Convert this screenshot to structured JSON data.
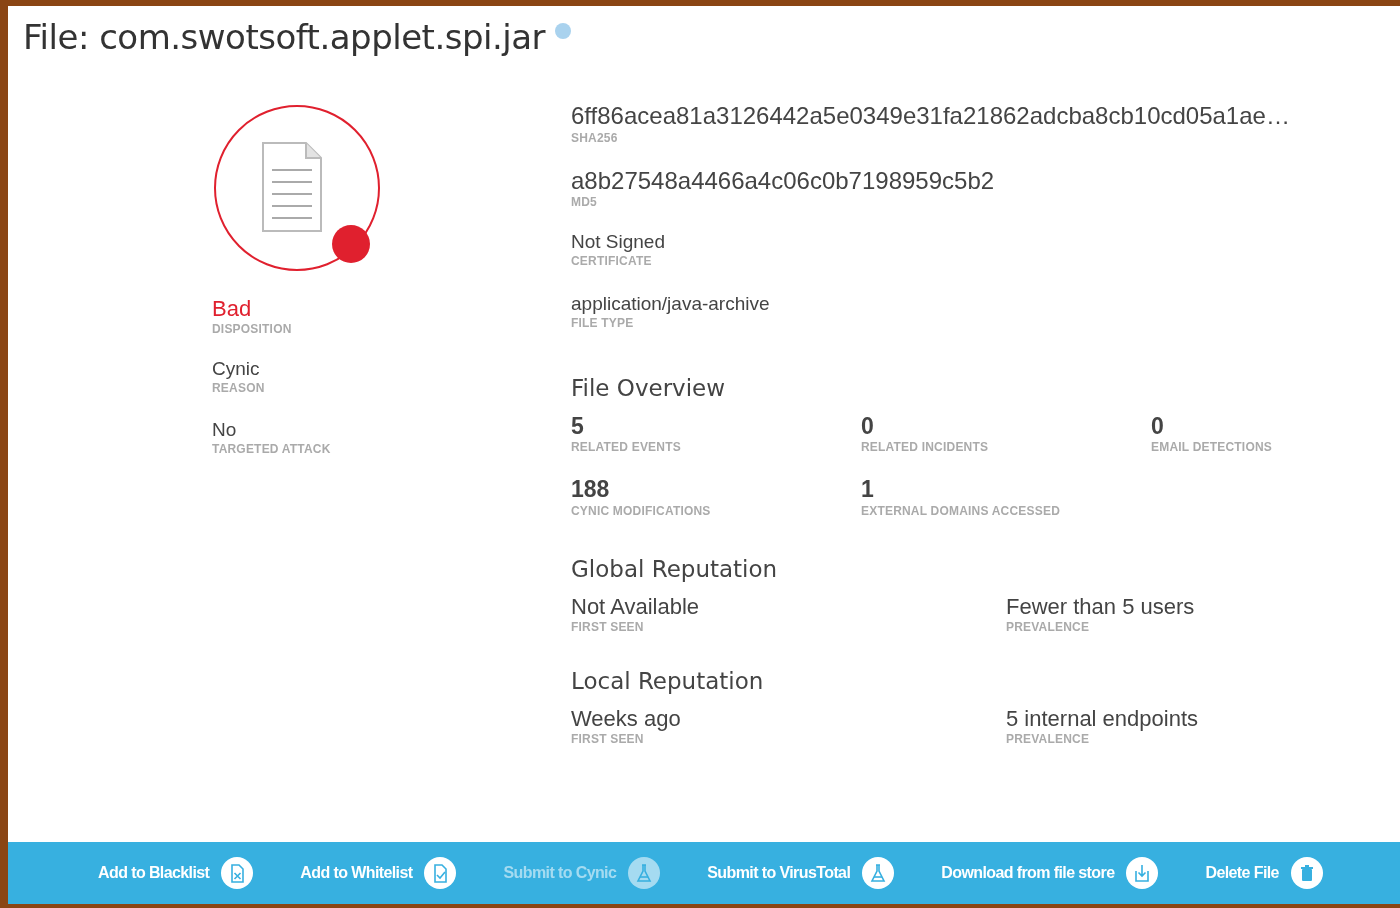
{
  "title": "File: com.swotsoft.applet.spi.jar",
  "disposition": {
    "value": "Bad",
    "label": "DISPOSITION",
    "color": "#e0202e"
  },
  "left_fields": [
    {
      "value": "Cynic",
      "label": "REASON"
    },
    {
      "value": "No",
      "label": "TARGETED ATTACK"
    }
  ],
  "hashes": [
    {
      "value": "6ff86acea81a3126442a5e0349e31fa21862adcba8cb10cd05a1ae…",
      "label": "SHA256",
      "kind": "large"
    },
    {
      "value": "a8b27548a4466a4c06c0b7198959c5b2",
      "label": "MD5",
      "kind": "large"
    },
    {
      "value": "Not Signed",
      "label": "CERTIFICATE",
      "kind": "small"
    },
    {
      "value": "application/java-archive",
      "label": "FILE TYPE",
      "kind": "small"
    }
  ],
  "file_overview": {
    "title": "File Overview",
    "stats": [
      {
        "value": "5",
        "label": "RELATED EVENTS"
      },
      {
        "value": "0",
        "label": "RELATED INCIDENTS"
      },
      {
        "value": "0",
        "label": "EMAIL DETECTIONS"
      },
      {
        "value": "188",
        "label": "CYNIC MODIFICATIONS"
      },
      {
        "value": "1",
        "label": "EXTERNAL DOMAINS ACCESSED"
      }
    ]
  },
  "global_reputation": {
    "title": "Global Reputation",
    "fields": [
      {
        "value": "Not Available",
        "label": "FIRST SEEN"
      },
      {
        "value": "Fewer than 5 users",
        "label": "PREVALENCE"
      }
    ]
  },
  "local_reputation": {
    "title": "Local Reputation",
    "fields": [
      {
        "value": "Weeks ago",
        "label": "FIRST SEEN"
      },
      {
        "value": "5 internal endpoints",
        "label": "PREVALENCE"
      }
    ]
  },
  "actions": [
    {
      "label": "Add to Blacklist",
      "kind": "blacklist",
      "disabled": false
    },
    {
      "label": "Add to Whitelist",
      "kind": "whitelist",
      "disabled": false
    },
    {
      "label": "Submit to Cynic",
      "kind": "flask",
      "disabled": true
    },
    {
      "label": "Submit to VirusTotal",
      "kind": "flask",
      "disabled": false
    },
    {
      "label": "Download from file store",
      "kind": "download",
      "disabled": false
    },
    {
      "label": "Delete File",
      "kind": "trash",
      "disabled": false
    }
  ]
}
